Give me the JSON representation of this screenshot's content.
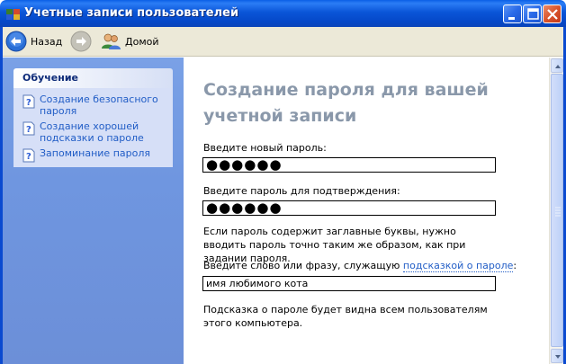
{
  "window": {
    "title": "Учетные записи пользователей"
  },
  "toolbar": {
    "back_label": "Назад",
    "home_label": "Домой"
  },
  "sidebar": {
    "header": "Обучение",
    "items": [
      {
        "label": "Создание безопасного пароля",
        "icon": "help-page-icon"
      },
      {
        "label": "Создание хорошей подсказки о пароле",
        "icon": "help-page-icon"
      },
      {
        "label": "Запоминание пароля",
        "icon": "help-page-icon"
      }
    ]
  },
  "main": {
    "heading": "Создание пароля для вашей учетной записи",
    "new_password_label": "Введите новый пароль:",
    "new_password_value": "●●●●●●",
    "confirm_label": "Введите пароль для подтверждения:",
    "confirm_value": "●●●●●●",
    "caps_note": "Если пароль содержит заглавные буквы, нужно вводить пароль точно таким же образом, как при задании пароля.",
    "hint_label_prefix": "Введите слово или фразу, служащую ",
    "hint_label_link": "подсказкой о пароле",
    "hint_label_suffix": ":",
    "hint_value": "имя любимого кота",
    "hint_note": "Подсказка о пароле будет видна всем пользователям этого компьютера."
  },
  "colors": {
    "titlebar": "#0a55d8",
    "sidebar": "#6f96e0",
    "link": "#215dc6",
    "heading": "#8a98aa"
  }
}
